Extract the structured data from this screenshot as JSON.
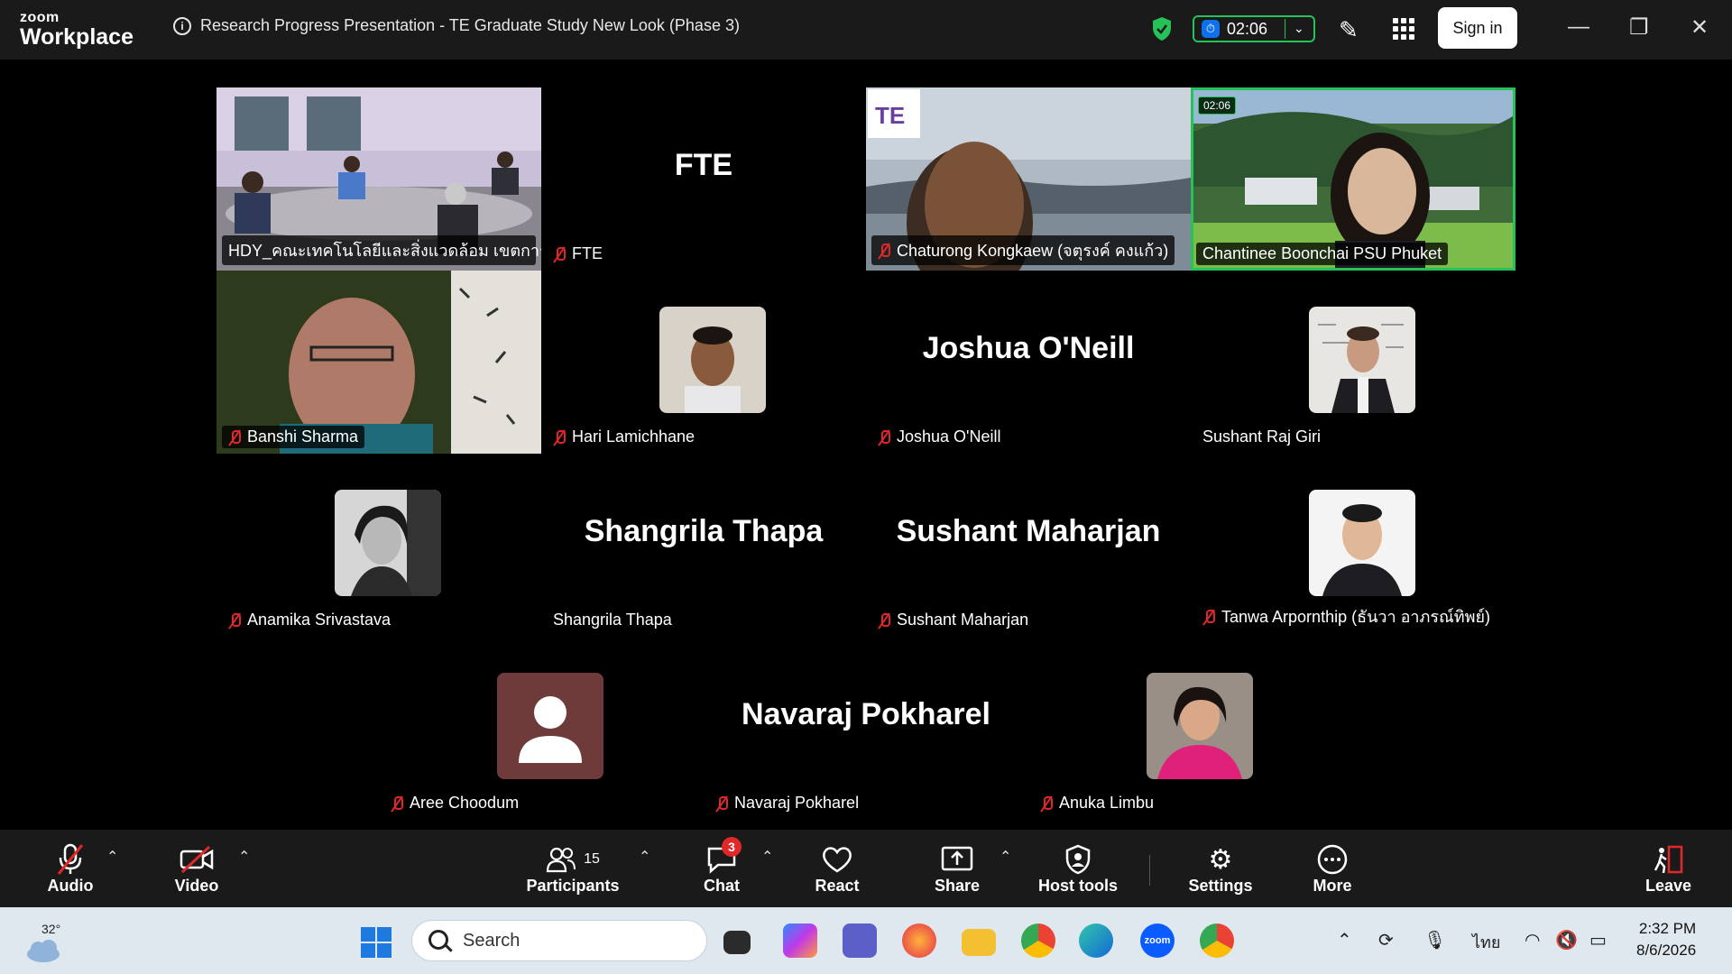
{
  "app": {
    "brand_top": "zoom",
    "brand_bottom": "Workplace"
  },
  "meeting": {
    "title": "Research Progress Presentation - TE Graduate Study New Look (Phase 3)",
    "elapsed": "02:06"
  },
  "header": {
    "sign_in": "Sign in"
  },
  "participants": [
    {
      "name": "HDY_คณะเทคโนโลยีและสิ่งแวดล้อม เขตการศึ...",
      "muted": false,
      "kind": "video"
    },
    {
      "name": "FTE",
      "muted": true,
      "kind": "name",
      "display": "FTE"
    },
    {
      "name": "Chaturong Kongkaew (จตุรงค์ คงแก้ว)",
      "muted": true,
      "kind": "video"
    },
    {
      "name": "Chantinee Boonchai PSU Phuket",
      "muted": false,
      "kind": "video",
      "speaking": true,
      "timer": "02:06"
    },
    {
      "name": "Banshi Sharma",
      "muted": true,
      "kind": "video"
    },
    {
      "name": "Hari Lamichhane",
      "muted": true,
      "kind": "avatar"
    },
    {
      "name": "Joshua O'Neill",
      "muted": true,
      "kind": "name",
      "display": "Joshua O'Neill"
    },
    {
      "name": "Sushant Raj Giri",
      "muted": false,
      "kind": "avatar"
    },
    {
      "name": "Anamika Srivastava",
      "muted": true,
      "kind": "avatar"
    },
    {
      "name": "Shangrila Thapa",
      "muted": false,
      "kind": "name",
      "display": "Shangrila Thapa"
    },
    {
      "name": "Sushant Maharjan",
      "muted": true,
      "kind": "name",
      "display": "Sushant Maharjan"
    },
    {
      "name": "Tanwa Arpornthip (ธันวา อาภรณ์ทิพย์)",
      "muted": true,
      "kind": "avatar"
    },
    {
      "name": "Aree Choodum",
      "muted": true,
      "kind": "placeholder"
    },
    {
      "name": "Navaraj Pokharel",
      "muted": true,
      "kind": "name",
      "display": "Navaraj Pokharel"
    },
    {
      "name": "Anuka Limbu",
      "muted": true,
      "kind": "avatar"
    }
  ],
  "toolbar": {
    "audio": "Audio",
    "video": "Video",
    "participants": "Participants",
    "participants_count": "15",
    "chat": "Chat",
    "chat_badge": "3",
    "react": "React",
    "share": "Share",
    "host_tools": "Host tools",
    "settings": "Settings",
    "more": "More",
    "leave": "Leave"
  },
  "taskbar": {
    "temperature": "32°",
    "search_placeholder": "Search",
    "language": "ไทย",
    "time": "2:32 PM",
    "date": "8/6/2026",
    "zoom_label": "zoom"
  },
  "colors": {
    "speaking": "#27c15a",
    "muted": "#e02828",
    "accent": "#0e71eb"
  }
}
